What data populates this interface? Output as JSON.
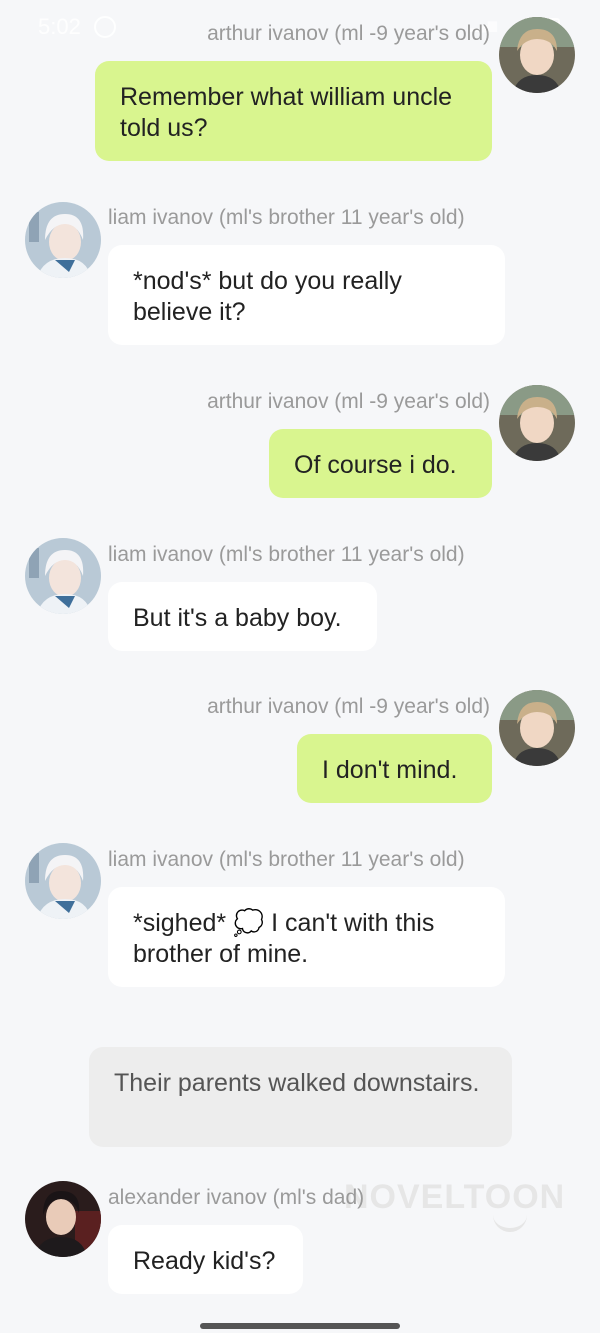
{
  "status_bar": {
    "time": "5:02",
    "battery": "4"
  },
  "characters": {
    "arthur": "arthur ivanov (ml -9 year's old)",
    "liam": "liam ivanov (ml's brother 11 year's old)",
    "alexander": "alexander ivanov (ml's dad)"
  },
  "messages": [
    {
      "speaker": "arthur",
      "text": "Remember what william uncle told us?"
    },
    {
      "speaker": "liam",
      "text": "*nod's* but do you really believe it?"
    },
    {
      "speaker": "arthur",
      "text": "Of course i do."
    },
    {
      "speaker": "liam",
      "text": "But it's a baby boy."
    },
    {
      "speaker": "arthur",
      "text": "I don't mind."
    },
    {
      "speaker": "liam",
      "text": "*sighed* 💭 I can't with this brother of mine."
    },
    {
      "speaker": "narration",
      "text": "Their parents walked downstairs."
    },
    {
      "speaker": "alexander",
      "text": "Ready kid's?"
    }
  ],
  "watermark": "NOVELTOON"
}
